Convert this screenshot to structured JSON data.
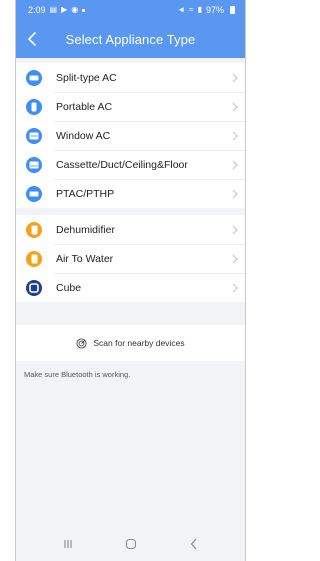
{
  "status_bar": {
    "time": "2:09",
    "battery": "97%"
  },
  "header": {
    "title": "Select Appliance Type"
  },
  "groups": [
    {
      "items": [
        {
          "label": "Split-type AC",
          "icon": "split-ac-icon",
          "color": "#3f8ef5"
        },
        {
          "label": "Portable AC",
          "icon": "portable-ac-icon",
          "color": "#3f8ef5"
        },
        {
          "label": "Window AC",
          "icon": "window-ac-icon",
          "color": "#3f8ef5"
        },
        {
          "label": "Cassette/Duct/Ceiling&Floor",
          "icon": "cassette-ac-icon",
          "color": "#3f8ef5"
        },
        {
          "label": "PTAC/PTHP",
          "icon": "ptac-icon",
          "color": "#3f8ef5"
        }
      ]
    },
    {
      "items": [
        {
          "label": "Dehumidifier",
          "icon": "dehumidifier-icon",
          "color": "#f5a21b"
        },
        {
          "label": "Air To Water",
          "icon": "air-to-water-icon",
          "color": "#f5a21b"
        },
        {
          "label": "Cube",
          "icon": "cube-icon",
          "color": "#1d3f8c"
        }
      ]
    }
  ],
  "scan": {
    "label": "Scan for nearby devices",
    "note": "Make sure Bluetooth is working."
  },
  "colors": {
    "header": "#5a97f0",
    "blue": "#3f8ef5",
    "orange": "#f5a21b",
    "navy": "#1d3f8c"
  }
}
